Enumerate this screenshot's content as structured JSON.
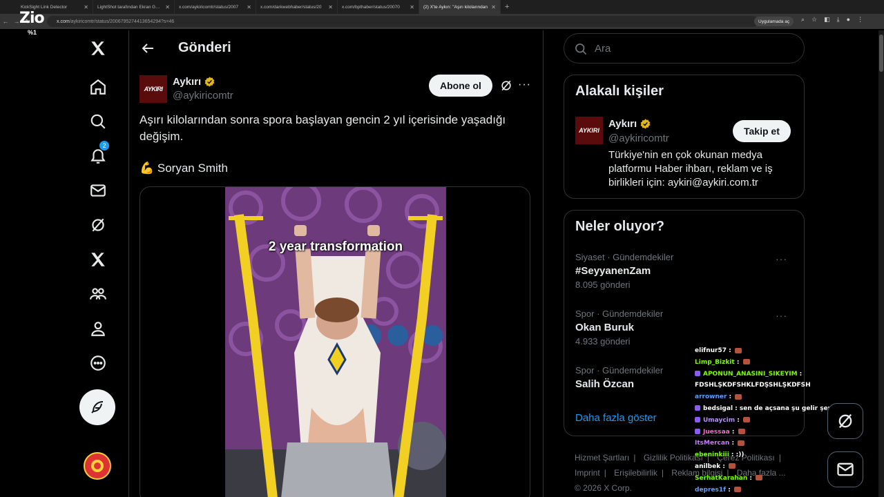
{
  "browser": {
    "tabs": [
      {
        "title": "KickSight Link Detector",
        "active": false
      },
      {
        "title": "LightShot tarafından Ekran Görüntüsü",
        "active": false
      },
      {
        "title": "x.com/aykiricomtr/status/2007",
        "active": false
      },
      {
        "title": "x.com/darkwebhaber/status/20",
        "active": false
      },
      {
        "title": "x.com/bpthaber/status/20070",
        "active": false
      },
      {
        "title": "(2) X'te Aykırı: \"Aşırı kilolarından",
        "active": true
      }
    ],
    "url_domain": "x.com",
    "url_path": "/aykiricomtr/status/2006795274413654294?s=46",
    "open_in_app": "Uygulamada aç"
  },
  "overlay": {
    "logo": "Zio",
    "percent": "%1"
  },
  "nav": {
    "notifications_badge": "2",
    "icons": [
      "x-logo-icon",
      "home-icon",
      "explore-icon",
      "notifications-icon",
      "messages-icon",
      "grok-icon",
      "premium-x-icon",
      "communities-icon",
      "profile-icon",
      "more-icon"
    ]
  },
  "header": {
    "title": "Gönderi"
  },
  "tweet": {
    "author_name": "Aykırı",
    "author_handle": "@aykiricomtr",
    "avatar_text": "AYKIRI",
    "subscribe_label": "Abone ol",
    "text": "Aşırı kilolarından sonra spora başlayan gencin 2 yıl içerisinde yaşadığı değişim.",
    "credit": "💪 Soryan Smith",
    "video_caption": "2 year transformation"
  },
  "search": {
    "placeholder": "Ara"
  },
  "related": {
    "title": "Alakalı kişiler",
    "name": "Aykırı",
    "handle": "@aykiricomtr",
    "avatar_text": "AYKIRI",
    "follow_label": "Takip et",
    "bio": "Türkiye'nin en çok okunan medya platformu Haber ihbarı, reklam ve iş birlikleri için: aykiri@aykiri.com.tr"
  },
  "trends": {
    "title": "Neler oluyor?",
    "items": [
      {
        "meta": "Siyaset · Gündemdekiler",
        "title": "#SeyyanenZam",
        "count": "8.095 gönderi"
      },
      {
        "meta": "Spor · Gündemdekiler",
        "title": "Okan Buruk",
        "count": "4.933 gönderi"
      },
      {
        "meta": "Spor · Gündemdekiler",
        "title": "Salih Özcan",
        "count": ""
      }
    ],
    "show_more": "Daha fazla göster"
  },
  "footer": {
    "links": [
      "Hizmet Şartları",
      "Gizlilik Politikası",
      "Çerez Politikası",
      "Imprint",
      "Erişilebilirlik",
      "Reklam bilgisi",
      "Daha fazla ..."
    ],
    "copyright": "© 2026 X Corp."
  },
  "chat": [
    {
      "user": "elifnur57",
      "msg": "",
      "color": "#ffffff",
      "emote": true,
      "badge": false
    },
    {
      "user": "Limp_Bizkit",
      "msg": "",
      "color": "#7cfc00",
      "emote": true,
      "badge": false
    },
    {
      "user": "APONUN_ANASINI_SIKEYIM",
      "msg": "FDSHLŞKDFSHKLFDŞSHLŞKDFSH",
      "color": "#7cfc00",
      "emote": false,
      "badge": true
    },
    {
      "user": "arrowner",
      "msg": "",
      "color": "#5aa0ff",
      "emote": true,
      "badge": false
    },
    {
      "user": "bedsigal",
      "msg": "sen de açsana şu gelir şeyini",
      "color": "#ffffff",
      "emote": false,
      "badge": true
    },
    {
      "user": "Umaycim",
      "msg": "",
      "color": "#b48cff",
      "emote": true,
      "badge": true
    },
    {
      "user": "Juessaa",
      "msg": "",
      "color": "#ff66cc",
      "emote": true,
      "badge": true
    },
    {
      "user": "ItsMercan",
      "msg": "",
      "color": "#c77dff",
      "emote": true,
      "badge": false
    },
    {
      "user": "ebeninkiii",
      "msg": ":))",
      "color": "#7cfc00",
      "emote": false,
      "badge": false
    },
    {
      "user": "anilbek",
      "msg": "",
      "color": "#ffffff",
      "emote": true,
      "badge": false
    },
    {
      "user": "SerhatKarahan",
      "msg": "",
      "color": "#7cfc00",
      "emote": true,
      "badge": false
    },
    {
      "user": "depres1f",
      "msg": "",
      "color": "#5aa0ff",
      "emote": true,
      "badge": false
    }
  ],
  "colors": {
    "background": "#000000",
    "border": "#2f3336",
    "text": "#e7e9ea",
    "muted": "#71767b",
    "accent": "#1d9bf0",
    "verified_gold": "#e2b719"
  }
}
